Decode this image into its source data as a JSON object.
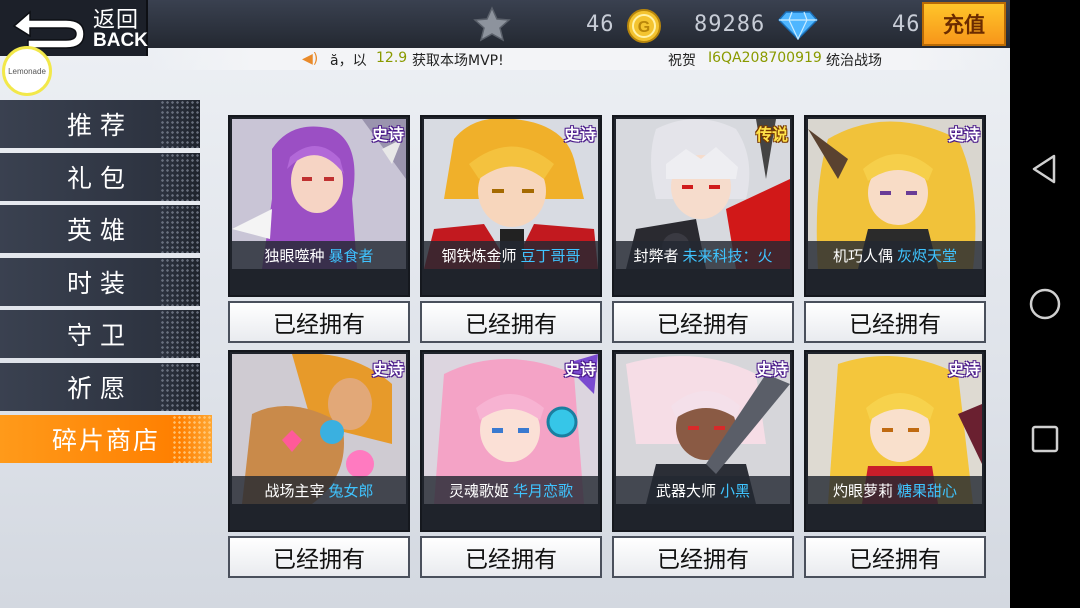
{
  "header": {
    "back_label_cn": "返回",
    "back_label_en": "BACK",
    "avatar_text": "Lemonade",
    "stars": "46",
    "coins": "89286",
    "diamonds": "46",
    "recharge_label": "充值"
  },
  "ticker": {
    "part1": "ă，以",
    "part1_value": "12.9",
    "part1_tail": "获取本场MVP!",
    "part2": "祝贺",
    "part2_player": "I6QA208700919",
    "part2_tail": "统治战场"
  },
  "sidebar": {
    "items": [
      {
        "label": "推荐"
      },
      {
        "label": "礼包"
      },
      {
        "label": "英雄"
      },
      {
        "label": "时装"
      },
      {
        "label": "守卫"
      },
      {
        "label": "祈愿"
      },
      {
        "label": "碎片商店"
      }
    ],
    "active_index": 6
  },
  "cards": [
    {
      "rarity": "史诗",
      "name": "独眼噬种",
      "skin": "暴食者",
      "button": "已经拥有"
    },
    {
      "rarity": "史诗",
      "name": "钢铁炼金师",
      "skin": "豆丁哥哥",
      "button": "已经拥有"
    },
    {
      "rarity": "传说",
      "name": "封弊者",
      "skin": "未来科技：火",
      "button": "已经拥有"
    },
    {
      "rarity": "史诗",
      "name": "机巧人偶",
      "skin": "灰烬天堂",
      "button": "已经拥有"
    },
    {
      "rarity": "史诗",
      "name": "战场主宰",
      "skin": "兔女郎",
      "button": "已经拥有"
    },
    {
      "rarity": "史诗",
      "name": "灵魂歌姬",
      "skin": "华月恋歌",
      "button": "已经拥有"
    },
    {
      "rarity": "史诗",
      "name": "武器大师",
      "skin": "小黑",
      "button": "已经拥有"
    },
    {
      "rarity": "史诗",
      "name": "灼眼萝莉",
      "skin": "糖果甜心",
      "button": "已经拥有"
    }
  ],
  "colors": {
    "accent_orange": "#ff8a0a",
    "skin_name_blue": "#3fc4ff",
    "epic_purple": "#4a1a8a",
    "legend_gold": "#ffe34a"
  }
}
